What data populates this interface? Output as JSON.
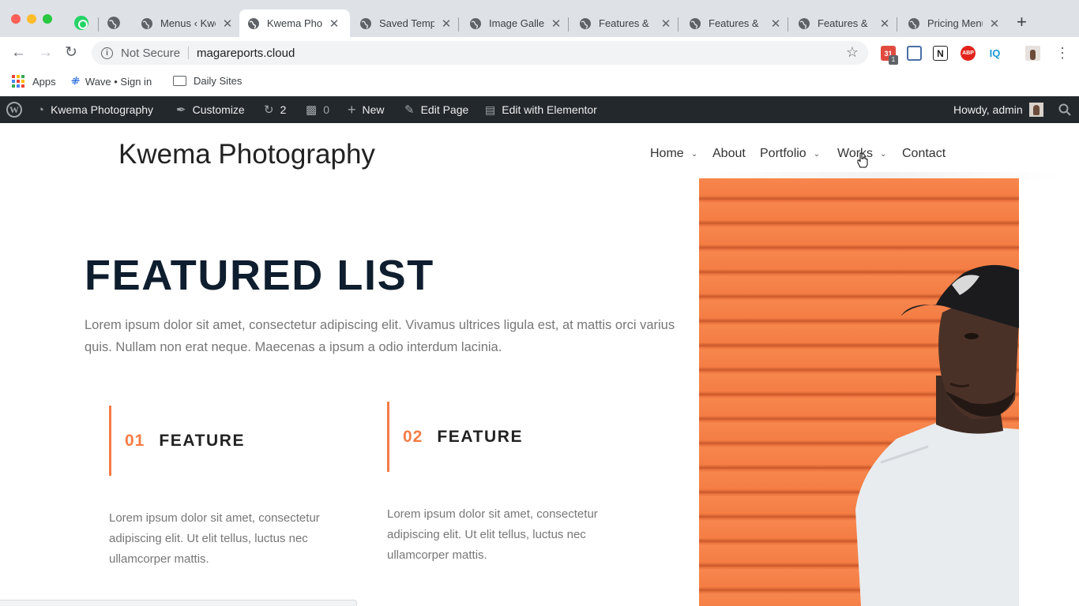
{
  "browser": {
    "tabs": [
      {
        "label": "Menus ‹ Kwema Photography",
        "active": false
      },
      {
        "label": "Kwema Photography",
        "active": true
      },
      {
        "label": "Saved Templates",
        "active": false
      },
      {
        "label": "Image Gallery",
        "active": false
      },
      {
        "label": "Features &",
        "active": false
      },
      {
        "label": "Features &",
        "active": false
      },
      {
        "label": "Features &",
        "active": false
      },
      {
        "label": "Pricing Menu",
        "active": false
      }
    ],
    "close_glyph": "✕",
    "new_tab_glyph": "+",
    "security_label": "Not Secure",
    "url": "magareports.cloud",
    "extension_badge": "1",
    "extensions": [
      "calendar-icon",
      "printer-icon",
      "notion-icon",
      "abp-icon",
      "iq-icon",
      "profile-icon",
      "menu-dots-icon"
    ],
    "extension_labels": {
      "notion": "N",
      "abp": "ABP",
      "iq": "IQ",
      "calendar": "31"
    }
  },
  "bookmarks": [
    {
      "label": "Apps",
      "icon": "apps-grid-icon"
    },
    {
      "label": "Wave • Sign in",
      "icon": "wave-icon"
    },
    {
      "label": "Daily Sites",
      "icon": "folder-icon"
    }
  ],
  "admin_bar": {
    "site_name": "Kwema Photography",
    "customize": "Customize",
    "updates_count": "2",
    "comments_count": "0",
    "new": "New",
    "edit_page": "Edit Page",
    "edit_elementor": "Edit with Elementor",
    "howdy": "Howdy, admin"
  },
  "site": {
    "title": "Kwema Photography",
    "menu": [
      {
        "label": "Home",
        "has_dropdown": true
      },
      {
        "label": "About",
        "has_dropdown": false
      },
      {
        "label": "Portfolio",
        "has_dropdown": true
      },
      {
        "label": "Works",
        "has_dropdown": true
      },
      {
        "label": "Contact",
        "has_dropdown": false
      }
    ]
  },
  "hero": {
    "title": "FEATURED LIST",
    "description": "Lorem ipsum dolor sit amet, consectetur adipiscing elit. Vivamus ultrices ligula est, at mattis orci varius quis. Nullam non erat neque. Maecenas a ipsum a odio interdum lacinia.",
    "features": [
      {
        "number": "01",
        "title": "FEATURE",
        "text": "Lorem ipsum dolor sit amet, consectetur adipiscing elit. Ut elit tellus, luctus nec ullamcorper mattis."
      },
      {
        "number": "02",
        "title": "FEATURE",
        "text": "Lorem ipsum dolor sit amet, consectetur adipiscing elit. Ut elit tellus, luctus nec ullamcorper mattis."
      }
    ]
  },
  "colors": {
    "accent": "#f57c45",
    "heading": "#0f1e2e",
    "admin_bar": "#23282d",
    "photo_bg": "#f7864d"
  }
}
